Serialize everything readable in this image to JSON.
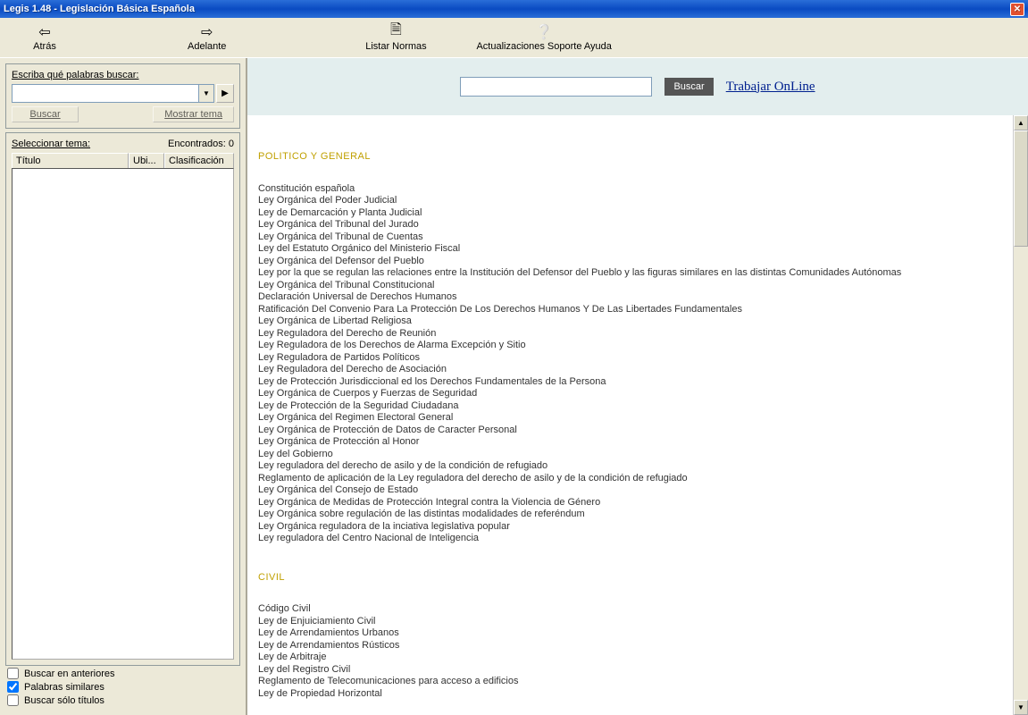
{
  "window": {
    "title": "Legis 1.48 - Legislación Básica Española",
    "close": "X"
  },
  "toolbar": {
    "back": "Atrás",
    "forward": "Adelante",
    "list": "Listar Normas",
    "updates": "Actualizaciones Soporte Ayuda"
  },
  "sidebar": {
    "search_label": "Escriba qué palabras buscar:",
    "search_value": "",
    "go": "▶",
    "buscar": "Buscar",
    "mostrar": "Mostrar tema",
    "select_tema": "Seleccionar tema:",
    "encontrados": "Encontrados: 0",
    "col_titulo": "Título",
    "col_ubi": "Ubi...",
    "col_clas": "Clasificación",
    "chk_anteriores": "Buscar en anteriores",
    "chk_similares": "Palabras similares",
    "chk_titulos": "Buscar sólo títulos"
  },
  "top_search": {
    "value": "",
    "buscar": "Buscar",
    "online": "Trabajar OnLine"
  },
  "doc": {
    "sec1_title": "POLITICO Y GENERAL",
    "sec1_items": [
      "Constitución española",
      "Ley Orgánica del Poder Judicial",
      "Ley de Demarcación y Planta Judicial",
      "Ley Orgánica del Tribunal del Jurado",
      "Ley Orgánica del Tribunal de Cuentas",
      "Ley del Estatuto Orgánico del Ministerio Fiscal",
      "Ley Orgánica del Defensor del Pueblo",
      "Ley por la que se regulan las relaciones entre la Institución del Defensor del Pueblo y las figuras similares en las distintas Comunidades Autónomas",
      "Ley Orgánica del Tribunal Constitucional",
      "Declaración Universal de Derechos Humanos",
      "Ratificación Del Convenio Para La Protección De Los Derechos Humanos Y De Las Libertades Fundamentales",
      "Ley Orgánica de Libertad Religiosa",
      "Ley Reguladora del Derecho de Reunión",
      "Ley Reguladora de los Derechos de Alarma Excepción y Sitio",
      "Ley Reguladora de Partidos Políticos",
      "Ley Reguladora del Derecho de Asociación",
      "Ley de Protección Jurisdiccional ed los Derechos Fundamentales de la Persona",
      "Ley Orgánica de Cuerpos y Fuerzas de Seguridad",
      "Ley de Protección de la Seguridad Ciudadana",
      "Ley Orgánica del Regimen Electoral General",
      "Ley Orgánica de Protección de Datos de Caracter Personal",
      "Ley Orgánica de Protección al Honor",
      "Ley del Gobierno",
      "Ley reguladora del derecho de asilo y de la condición de refugiado",
      "Reglamento de aplicación de la Ley reguladora del derecho de asilo y de la condición de refugiado",
      "Ley Orgánica del Consejo de Estado",
      "Ley Orgánica de Medidas de Protección Integral contra la Violencia de Género",
      "Ley Orgánica sobre regulación de las distintas modalidades de referéndum",
      "Ley Orgánica reguladora de la inciativa legislativa popular",
      "Ley reguladora del Centro Nacional de Inteligencia"
    ],
    "sec2_title": "CIVIL",
    "sec2_items": [
      "Código Civil",
      "Ley de Enjuiciamiento Civil",
      "Ley de Arrendamientos Urbanos",
      "Ley de Arrendamientos Rústicos",
      "Ley de Arbitraje",
      "Ley del Registro Civil",
      "Reglamento de Telecomunicaciones para acceso a edificios",
      "Ley de Propiedad Horizontal"
    ]
  }
}
